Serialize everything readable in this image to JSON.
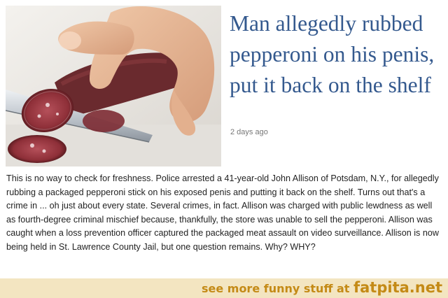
{
  "article": {
    "image_alt": "Hand slicing a pepperoni stick with a knife",
    "headline": "Man allegedly rubbed pepperoni on his penis, put it back on the shelf",
    "timestamp": "2 days ago",
    "body": "This is no way to check for freshness. Police arrested a 41-year-old John Allison of Potsdam, N.Y., for allegedly rubbing a packaged pepperoni stick on his exposed penis and putting it back on the shelf. Turns out that's a crime in ... oh just about every state. Several crimes, in fact. Allison was charged with public lewdness as well as fourth-degree criminal mischief because, thankfully, the store was unable to sell the pepperoni. Allison was caught when a loss prevention officer captured the packaged meat assault on video surveillance. Allison is now being held in St. Lawrence County Jail, but one question remains. Why? WHY?"
  },
  "footer": {
    "text": "see more funny stuff at",
    "brand": "fatpita.net"
  }
}
